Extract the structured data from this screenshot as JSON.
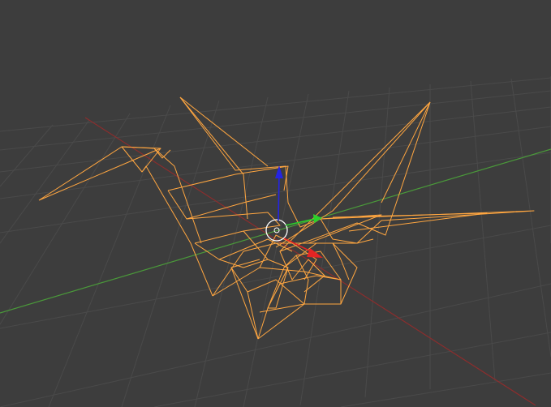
{
  "viewport": {
    "background_color": "#3d3d3d",
    "grid_color": "#4a4a4a",
    "x_axis_color": "#8c2d2d",
    "y_axis_color": "#4a9a3a",
    "selection_color": "#ffa640",
    "gizmo": {
      "x_color": "#e32424",
      "y_color": "#2bd12b",
      "z_color": "#2424e3",
      "pivot_color": "#ffffff"
    }
  }
}
